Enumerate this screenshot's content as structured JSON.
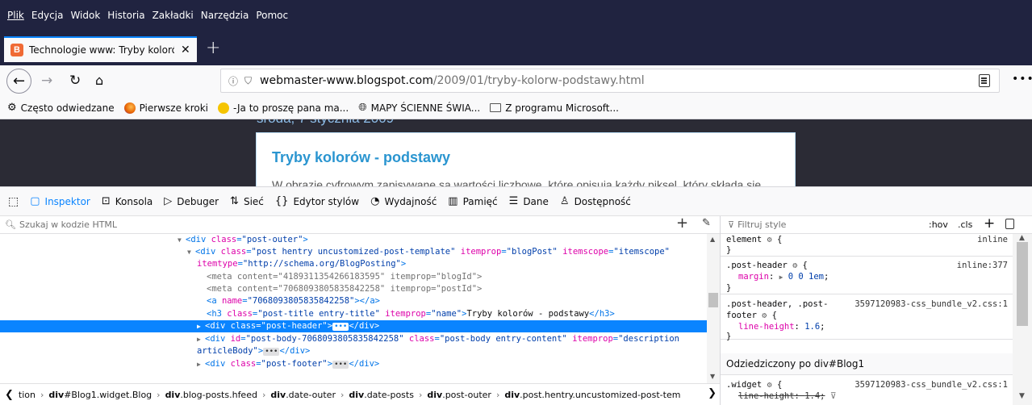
{
  "menubar": {
    "items": [
      "Plik",
      "Edycja",
      "Widok",
      "Historia",
      "Zakładki",
      "Narzędzia",
      "Pomoc"
    ]
  },
  "tab": {
    "favicon_letter": "B",
    "title": "Technologie www: Tryby koloró",
    "close": "✕"
  },
  "newtab": "+",
  "url": {
    "host": "webmaster-www.blogspot.com",
    "path": "/2009/01/tryby-kolorw-podstawy.html"
  },
  "bookmarks": [
    {
      "label": "Często odwiedzane",
      "icon": "gear-icon",
      "color": "#444444"
    },
    {
      "label": "Pierwsze kroki",
      "icon": "firefox-icon",
      "color": "#e66000"
    },
    {
      "label": "-Ja to proszę pana ma...",
      "icon": "smiley-icon",
      "color": "#f5c400"
    },
    {
      "label": "MAPY ŚCIENNE ŚWIA...",
      "icon": "globe-icon",
      "color": "#333333"
    },
    {
      "label": "Z programu Microsoft...",
      "icon": "folder-icon",
      "color": "#555555"
    }
  ],
  "page": {
    "date_partial": "środa, 7 stycznia 2009",
    "post_title": "Tryby kolorów - podstawy",
    "post_body_partial": "W obrazie cyfrowym zapisywane są wartości liczbowe, które opisują każdy piksel, który składa się"
  },
  "devtools": {
    "tabs": [
      {
        "label": "Inspektor",
        "icon": "inspector-icon",
        "active": true
      },
      {
        "label": "Konsola",
        "icon": "console-icon"
      },
      {
        "label": "Debuger",
        "icon": "debugger-icon"
      },
      {
        "label": "Sieć",
        "icon": "network-icon"
      },
      {
        "label": "Edytor stylów",
        "icon": "style-editor-icon"
      },
      {
        "label": "Wydajność",
        "icon": "performance-icon"
      },
      {
        "label": "Pamięć",
        "icon": "memory-icon"
      },
      {
        "label": "Dane",
        "icon": "storage-icon"
      },
      {
        "label": "Dostępność",
        "icon": "accessibility-icon"
      }
    ],
    "html_search_placeholder": "Szukaj w kodzie HTML",
    "styles_filter_placeholder": "Filtruj style",
    "hov": ":hov",
    "cls": ".cls",
    "add": "+",
    "breadcrumb": [
      {
        "label": "tion"
      },
      {
        "tag": "div",
        "rest": "#Blog1.widget.Blog"
      },
      {
        "tag": "div",
        "rest": ".blog-posts.hfeed"
      },
      {
        "tag": "div",
        "rest": ".date-outer"
      },
      {
        "tag": "div",
        "rest": ".date-posts"
      },
      {
        "tag": "div",
        "rest": ".post-outer"
      },
      {
        "tag": "div",
        "rest": ".post.hentry.uncustomized-post-tem"
      }
    ],
    "rules": {
      "element_selector": "element",
      "element_source": "inline",
      "r1_selector": ".post-header",
      "r1_source": "inline:377",
      "r1_prop": "margin",
      "r1_value": "0 0 1em",
      "r2_selector_a": ".post-header, .post-",
      "r2_selector_b": "footer",
      "r2_source": "3597120983-css_bundle_v2.css:1",
      "r2_prop": "line-height",
      "r2_value": "1.6",
      "inherited_header": "Odziedziczony po div#Blog1",
      "r3_selector": ".widget",
      "r3_source": "3597120983-css_bundle_v2.css:1",
      "r3_prop": "line-height",
      "r3_value": "1.4"
    }
  },
  "tree": {
    "l1_open": "<div",
    "l1_attr": "class",
    "l1_val": "\"post-outer\"",
    "l2_attr1": "class",
    "l2_val1": "\"post hentry uncustomized-post-template\"",
    "l2_attr2": "itemprop",
    "l2_val2": "\"blogPost\"",
    "l2_attr3": "itemscope",
    "l2_val3": "\"itemscope\"",
    "l3_attr": "itemtype",
    "l3_val": "\"http://schema.org/BlogPosting\"",
    "l4": "<meta content=\"4189311354266183595\" itemprop=\"blogId\">",
    "l5": "<meta content=\"7068093805835842258\" itemprop=\"postId\">",
    "l6_attr": "name",
    "l6_val": "\"7068093805835842258\"",
    "l7_attr1": "class",
    "l7_val1": "\"post-title entry-title\"",
    "l7_attr2": "itemprop",
    "l7_val2": "\"name\"",
    "l7_text": "Tryby kolorów - podstawy",
    "l8_attr": "class",
    "l8_val": "\"post-header\"",
    "l9_attr1": "id",
    "l9_val1": "\"post-body-7068093805835842258\"",
    "l9_attr2": "class",
    "l9_val2": "\"post-body entry-content\"",
    "l9_attr3": "itemprop",
    "l9_val3": "\"description",
    "l10_val": "articleBody\"",
    "l11_attr": "class",
    "l11_val": "\"post-footer\""
  }
}
